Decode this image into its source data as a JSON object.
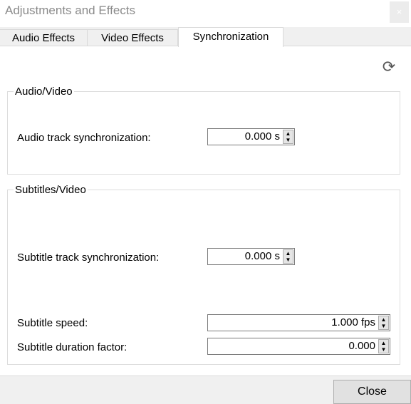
{
  "window": {
    "title": "Adjustments and Effects",
    "close_icon": "×"
  },
  "tabs": [
    {
      "label": "Audio Effects"
    },
    {
      "label": "Video Effects"
    },
    {
      "label": "Synchronization",
      "selected": true
    }
  ],
  "reset_icon": "⟳",
  "audio_video": {
    "title": "Audio/Video",
    "audio_sync_label": "Audio track synchronization:",
    "audio_sync_value": "0.000 s"
  },
  "subtitles_video": {
    "title": "Subtitles/Video",
    "sub_sync_label": "Subtitle track synchronization:",
    "sub_sync_value": "0.000 s",
    "speed_label": "Subtitle speed:",
    "speed_value": "1.000 fps",
    "duration_label": "Subtitle duration factor:",
    "duration_value": "0.000"
  },
  "footer": {
    "close_label": "Close"
  }
}
